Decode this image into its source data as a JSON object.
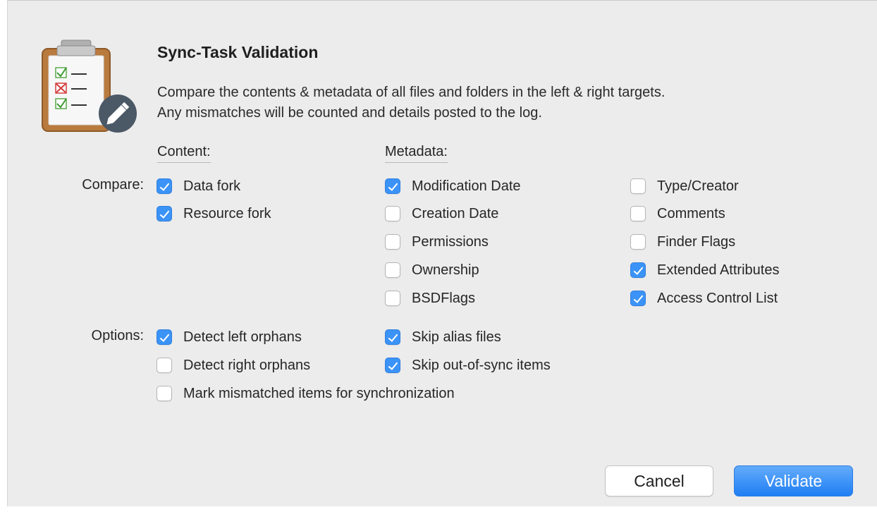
{
  "dialog": {
    "title": "Sync-Task Validation",
    "description_line1": "Compare the contents & metadata of all files and folders in the left & right targets.",
    "description_line2": "Any mismatches will be counted and details posted to the log.",
    "icon": "clipboard-checklist-pencil-icon"
  },
  "compare": {
    "label": "Compare:",
    "content_heading": "Content:",
    "metadata_heading": "Metadata:",
    "content_items": [
      {
        "label": "Data fork",
        "checked": true
      },
      {
        "label": "Resource fork",
        "checked": true
      }
    ],
    "metadata_col1": [
      {
        "label": "Modification Date",
        "checked": true
      },
      {
        "label": "Creation Date",
        "checked": false
      },
      {
        "label": "Permissions",
        "checked": false
      },
      {
        "label": "Ownership",
        "checked": false
      },
      {
        "label": "BSDFlags",
        "checked": false
      }
    ],
    "metadata_col2": [
      {
        "label": "Type/Creator",
        "checked": false
      },
      {
        "label": "Comments",
        "checked": false
      },
      {
        "label": "Finder Flags",
        "checked": false
      },
      {
        "label": "Extended Attributes",
        "checked": true
      },
      {
        "label": "Access Control List",
        "checked": true
      }
    ]
  },
  "options": {
    "label": "Options:",
    "items": [
      {
        "label": "Detect left orphans",
        "checked": true
      },
      {
        "label": "Detect right orphans",
        "checked": false
      },
      {
        "label": "Mark mismatched items for synchronization",
        "checked": false
      },
      {
        "label": "Skip alias files",
        "checked": true
      },
      {
        "label": "Skip out-of-sync items",
        "checked": true
      }
    ]
  },
  "buttons": {
    "cancel": "Cancel",
    "validate": "Validate"
  },
  "colors": {
    "accent": "#3b93f7",
    "dialog_bg": "#ececec"
  }
}
